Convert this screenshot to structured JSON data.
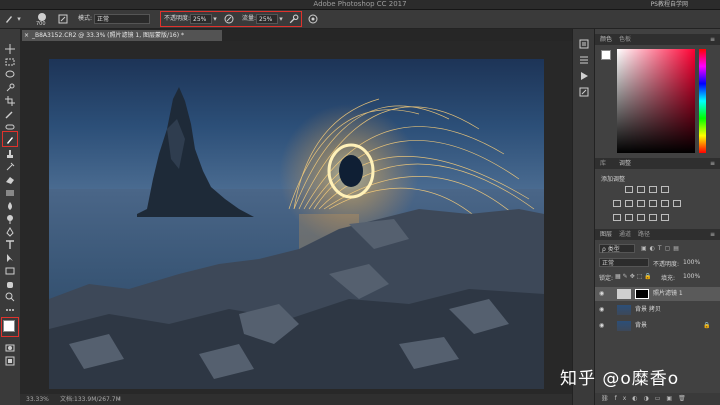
{
  "app": {
    "title": "Adobe Photoshop CC 2017",
    "watermark_top": "PS教程自学网"
  },
  "options": {
    "brush_size": "700",
    "mode_label": "模式:",
    "mode_value": "正常",
    "opacity_label": "不透明度:",
    "opacity_value": "25%",
    "flow_label": "流量:",
    "flow_value": "25%",
    "highlight_color": "#e0322c"
  },
  "document": {
    "tab_title": "_B8A3152.CR2 @ 33.3% (照片滤镜 1, 图层蒙版/16) *"
  },
  "status": {
    "zoom": "33.33%",
    "doc_size": "文档:133.9M/267.7M"
  },
  "color_panel": {
    "tab_color": "颜色",
    "tab_swatches": "色板"
  },
  "adjust_panel": {
    "tab_library": "库",
    "tab_adjust": "调整",
    "add_label": "添加调整"
  },
  "layers_panel": {
    "tab_layers": "图层",
    "tab_channels": "通道",
    "tab_paths": "路径",
    "kind_label": "ρ 类型",
    "blend_mode": "正常",
    "opacity_label": "不透明度:",
    "opacity_value": "100%",
    "lock_label": "锁定:",
    "fill_label": "填充:",
    "fill_value": "100%",
    "layers": [
      {
        "name": "照片滤镜 1"
      },
      {
        "name": "背景 拷贝"
      },
      {
        "name": "背景"
      }
    ]
  },
  "overlay": {
    "watermark": "知乎 @o糜香o"
  }
}
